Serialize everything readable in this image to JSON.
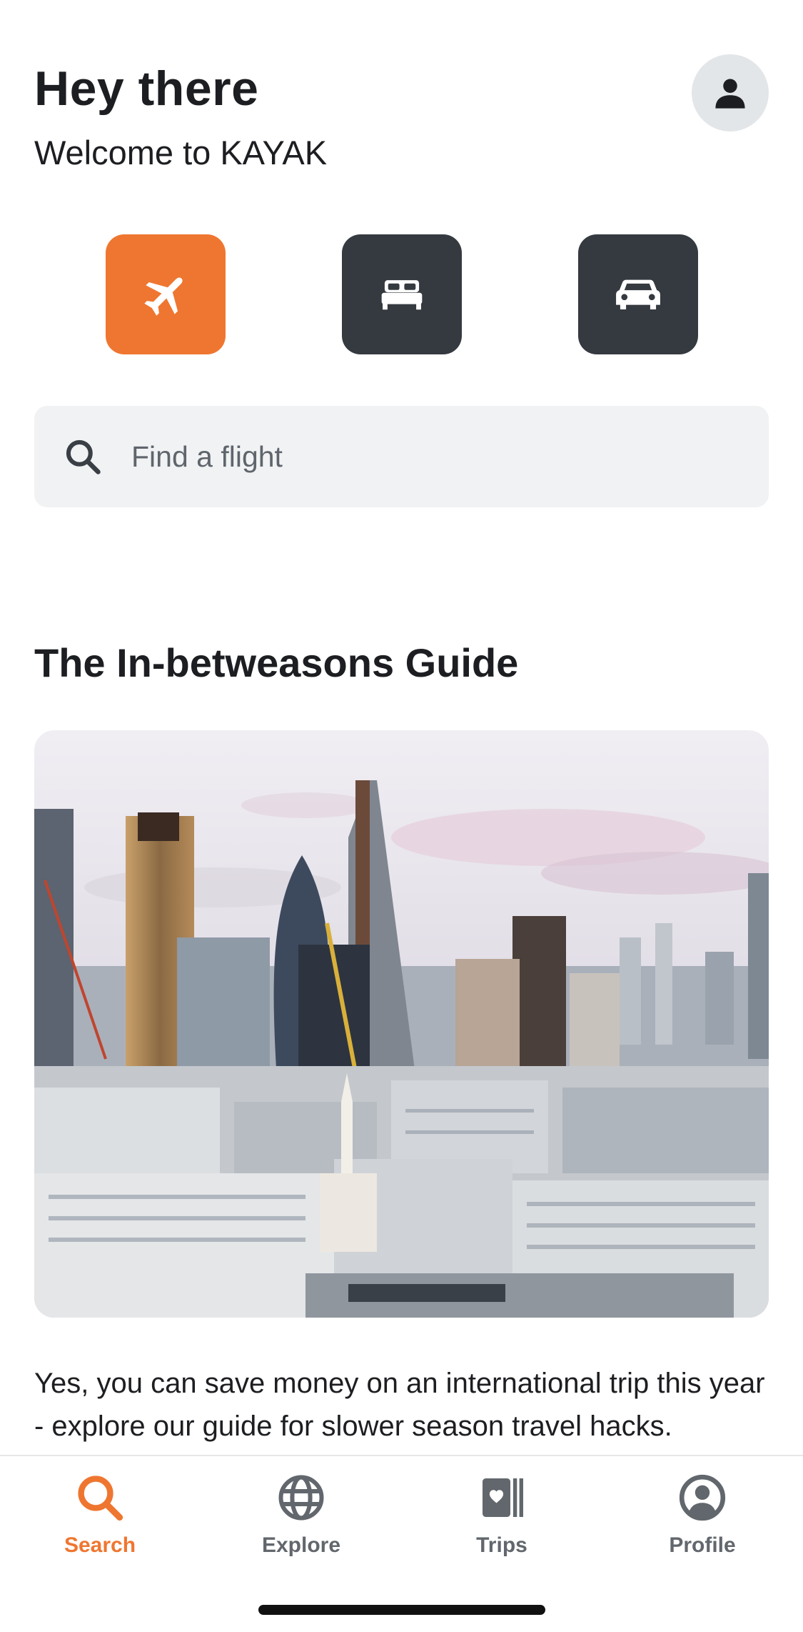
{
  "header": {
    "greeting": "Hey there",
    "welcome": "Welcome to KAYAK",
    "account_icon": "person-icon"
  },
  "verticals": [
    {
      "name": "flights",
      "icon": "airplane-icon",
      "active": true
    },
    {
      "name": "hotels",
      "icon": "bed-icon",
      "active": false
    },
    {
      "name": "cars",
      "icon": "car-icon",
      "active": false
    }
  ],
  "search": {
    "placeholder": "Find a flight",
    "value": "",
    "icon": "search-icon"
  },
  "guide": {
    "title": "The In-betweasons Guide",
    "text": "Yes, you can save money on an international trip this year - explore our guide for slower season travel hacks."
  },
  "tabbar": {
    "items": [
      {
        "label": "Search",
        "icon": "search-icon",
        "active": true
      },
      {
        "label": "Explore",
        "icon": "globe-icon",
        "active": false
      },
      {
        "label": "Trips",
        "icon": "trips-icon",
        "active": false
      },
      {
        "label": "Profile",
        "icon": "profile-icon",
        "active": false
      }
    ]
  },
  "colors": {
    "accent": "#ef7630",
    "dark_button": "#353a40",
    "search_bg": "#f1f2f3",
    "tab_inactive": "#62676d"
  }
}
